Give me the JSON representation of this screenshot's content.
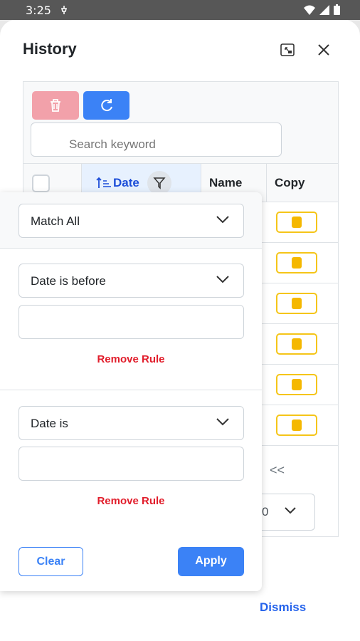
{
  "status_bar": {
    "time": "3:25"
  },
  "dialog": {
    "title": "History",
    "search": {
      "placeholder": "Search keyword"
    },
    "table": {
      "columns": {
        "date": "Date",
        "name": "Name",
        "copy": "Copy"
      },
      "rows": [
        {},
        {},
        {},
        {},
        {},
        {}
      ]
    },
    "pager": {
      "first_symbol": "<<",
      "rows_per_page_partial": "0"
    },
    "dismiss_label": "Dismiss"
  },
  "filter_popover": {
    "match_mode": "Match All",
    "rules": [
      {
        "constraint": "Date is before",
        "value": ""
      },
      {
        "constraint": "Date is",
        "value": ""
      }
    ],
    "remove_rule_label": "Remove Rule",
    "clear_label": "Clear",
    "apply_label": "Apply"
  },
  "colors": {
    "primary": "#3b82f6",
    "danger_light": "#f2a1aa",
    "danger_text": "#e11d2b",
    "copy_accent": "#f5c518"
  }
}
